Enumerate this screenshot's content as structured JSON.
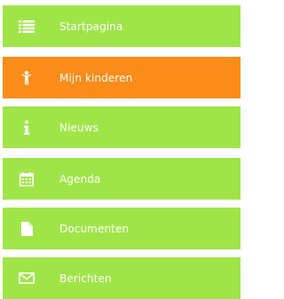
{
  "menu": {
    "colors": {
      "default_bg": "#a0e548",
      "active_bg": "#fb8c1a",
      "text": "#ffffff"
    },
    "items": [
      {
        "label": "Startpagina",
        "icon": "list-icon",
        "active": false
      },
      {
        "label": "Mijn kinderen",
        "icon": "child-icon",
        "active": true
      },
      {
        "label": "Nieuws",
        "icon": "info-icon",
        "active": false
      },
      {
        "label": "Agenda",
        "icon": "calendar-icon",
        "active": false
      },
      {
        "label": "Documenten",
        "icon": "document-icon",
        "active": false
      },
      {
        "label": "Berichten",
        "icon": "envelope-icon",
        "active": false
      }
    ]
  }
}
